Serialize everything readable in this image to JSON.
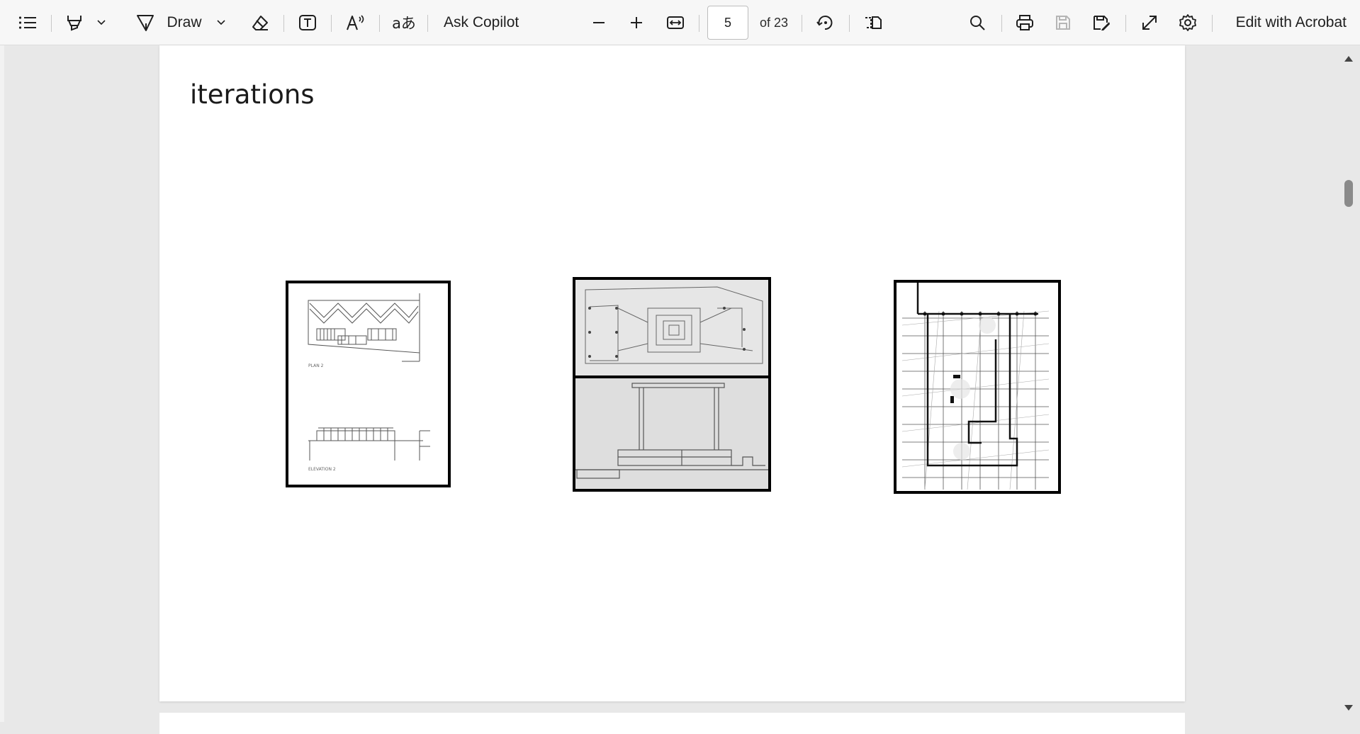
{
  "toolbar": {
    "draw_label": "Draw",
    "ask_copilot_label": "Ask Copilot",
    "page_number": "5",
    "page_total": "of 23",
    "edit_acrobat_label": "Edit with Acrobat",
    "icons": {
      "contents": "contents-list-icon",
      "highlight": "highlighter-icon",
      "highlight_menu": "chevron-down-icon",
      "draw": "draw-pen-icon",
      "draw_menu": "chevron-down-icon",
      "erase": "eraser-icon",
      "text": "add-text-icon",
      "read_aloud": "read-aloud-icon",
      "translate": "translate-icon",
      "zoom_out": "minus-icon",
      "zoom_in": "plus-icon",
      "fit_width": "fit-width-icon",
      "rotate": "rotate-icon",
      "page_view": "page-view-icon",
      "search": "search-icon",
      "print": "print-icon",
      "save": "save-icon",
      "save_as": "save-as-icon",
      "fullscreen": "fullscreen-icon",
      "settings": "gear-icon"
    }
  },
  "document": {
    "heading": "iterations",
    "figures": [
      {
        "name": "plan-and-elevation-sketch",
        "captions": [
          "PLAN 2",
          "ELEVATION 2"
        ]
      },
      {
        "name": "roof-plan-and-section-sketch"
      },
      {
        "name": "grid-plan-sketch"
      }
    ]
  },
  "colors": {
    "toolbar_bg": "#f7f7f7",
    "viewer_bg": "#e8e8e8",
    "page_bg": "#ffffff",
    "scroll_thumb": "#8a8a8a",
    "disabled_icon": "#b5b5b5"
  }
}
